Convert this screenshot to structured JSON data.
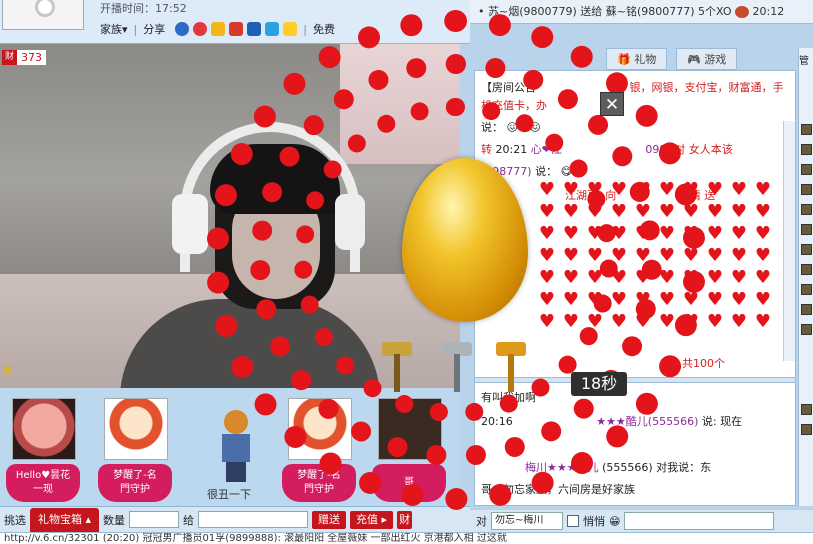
{
  "header": {
    "start_time": "开播时间：17:52",
    "family_label": "家族▾",
    "share_label": "分享",
    "free_label": "免费"
  },
  "video": {
    "fortune_icon": "财",
    "fortune_value": "373"
  },
  "gifts": [
    {
      "label": "Hello♥昙花\n一现"
    },
    {
      "label": "梦醒了-名\n門守护"
    },
    {
      "label": "很丑一下"
    },
    {
      "label": "梦醒了-名\n門守护"
    },
    {
      "label": "哥"
    }
  ],
  "bottombar": {
    "pick_label": "挑选",
    "gift_box_tab": "礼物宝箱 ▴",
    "quantity_label": "数量",
    "give_label": "给",
    "send_button": "赠送",
    "recharge_button": "充值 ▸",
    "fortune_icon": "财"
  },
  "notice": "• 苏~烟(9800779) 送给 蘇~铭(9800777) 5个XO",
  "notice_time": "20:12",
  "tabs": {
    "gift": "礼物",
    "game": "游戏"
  },
  "chat": {
    "announce": "【房间公告",
    "announce_pay": "银，网银，支付宝，财富通，手",
    "announce_pay2": "机充值卡，办",
    "said": "说：",
    "line3_time": "20:21",
    "line3_name": "心❤江",
    "line3_id": "099)",
    "line3_tail": "对 女人本该",
    "line4_id": "(898777)",
    "line4_said": "说：",
    "line5_name": "江湖哥: 向",
    "line5_tail": "情 送",
    "line6_tail": "，共100个",
    "line7": "有叫我加啊",
    "line8_time": "20:16",
    "line8_name": "★★★酷儿(555566)",
    "line8_tail": "说: 现在",
    "line9_name": "梅川★★★酷儿",
    "line9_tail": "(555566) 对我说：东",
    "line10": "哥，勿忘家族，六间房是好家族"
  },
  "chat_input": {
    "to_label": "对",
    "to_value": "勿忘~梅川",
    "whisper_label": "悄悄"
  },
  "users_header": "管",
  "overlay": {
    "countdown": "18秒"
  },
  "ticker": "http://v.6.cn/32301    (20:20)    冠冠男广播员01孚(9899888): 滚最阳阳    全屋薇妹    一部出红火    京港都入相    过这就"
}
